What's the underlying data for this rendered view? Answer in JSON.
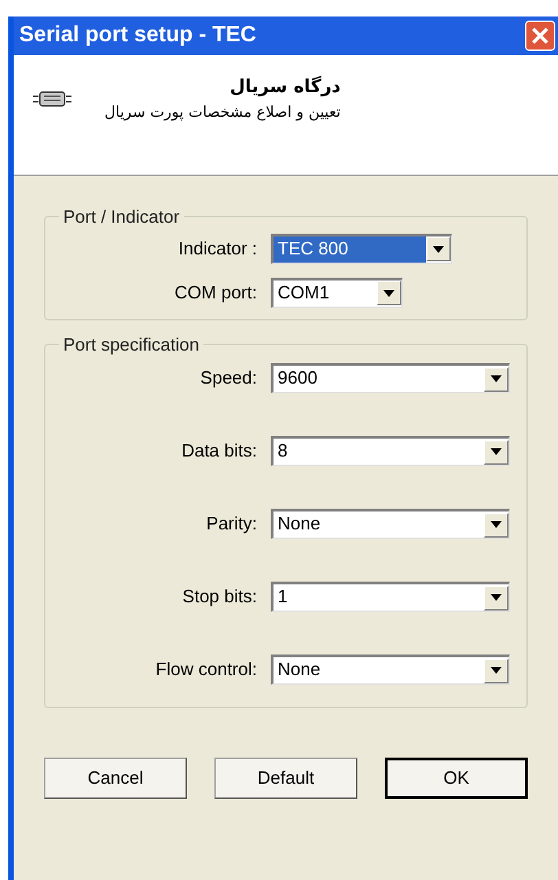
{
  "window": {
    "title": "Serial port setup - TEC"
  },
  "header": {
    "title": "درگاه سریال",
    "subtitle": "تعیین و اصلاع مشخصات پورت سریال"
  },
  "groups": [
    {
      "title": "Port / Indicator",
      "kind": "short",
      "fields": [
        {
          "label": "Indicator :",
          "value": "TEC 800",
          "highlighted": true
        },
        {
          "label": "COM port:",
          "value": "COM1",
          "highlighted": false
        }
      ]
    },
    {
      "title": "Port specification",
      "kind": "long",
      "fields": [
        {
          "label": "Speed:",
          "value": "9600",
          "highlighted": false
        },
        {
          "label": "Data bits:",
          "value": "8",
          "highlighted": false
        },
        {
          "label": "Parity:",
          "value": "None",
          "highlighted": false
        },
        {
          "label": "Stop bits:",
          "value": "1",
          "highlighted": false
        },
        {
          "label": "Flow control:",
          "value": "None",
          "highlighted": false
        }
      ]
    }
  ],
  "buttons": [
    {
      "label": "Cancel",
      "default": false
    },
    {
      "label": "Default",
      "default": false
    },
    {
      "label": "OK",
      "default": true
    }
  ]
}
